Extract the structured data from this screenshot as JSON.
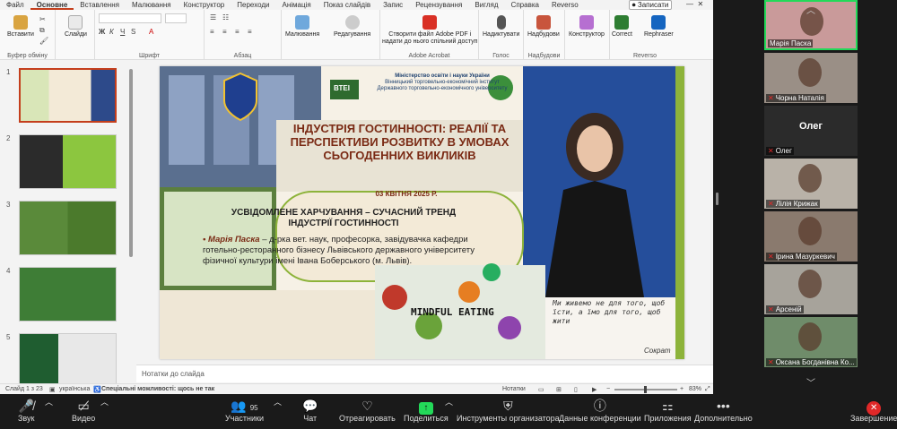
{
  "ribbon": {
    "tabs": [
      "Файл",
      "Основне",
      "Вставлення",
      "Малювання",
      "Конструктор",
      "Переходи",
      "Анімація",
      "Показ слайдів",
      "Запис",
      "Рецензування",
      "Вигляд",
      "Справка",
      "Reverso"
    ],
    "active_tab": "Основне",
    "record_label": "Записати",
    "groups": {
      "clipboard": {
        "paste": "Вставити",
        "label": "Буфер обміну"
      },
      "slides": {
        "new": "Слайди",
        "label": ""
      },
      "font": {
        "label": "Шрифт"
      },
      "paragraph": {
        "label": "Абзац"
      },
      "drawing": {
        "shapes": "Малювання",
        "edit": "Редагування"
      },
      "acrobat": {
        "create": "Створити файл Adobe PDF і",
        "create2": "надати до нього спільний доступ",
        "label": "Adobe Acrobat"
      },
      "voice": {
        "dictate": "Надиктувати",
        "label": "Голос"
      },
      "addins": {
        "addins": "Надбудови",
        "label": "Надбудови"
      },
      "designer": {
        "designer": "Конструктор"
      },
      "reverso": {
        "correct": "Correct",
        "rephrase": "Rephraser",
        "label": "Reverso"
      }
    }
  },
  "slide": {
    "ministry": "Міністерство освіти і науки України",
    "institute": "Вінницький торговельно-економічний інститут",
    "university": "Державного торговельно-економічного університету",
    "vtei": "ВТЕІ",
    "conf_title": "ІНДУСТРІЯ ГОСТИННОСТІ: РЕАЛІЇ ТА ПЕРСПЕКТИВИ РОЗВИТКУ В УМОВАХ СЬОГОДЕННИХ ВИКЛИКІВ",
    "date": "03 КВІТНЯ 2025 Р.",
    "talk_title": "УСВІДОМЛЕНЕ ХАРЧУВАННЯ – СУЧАСНИЙ ТРЕНД ІНДУСТРІЇ ГОСТИННОСТІ",
    "speaker": "Марія Паска",
    "speaker_info": " – д-рка вет. наук, професорка, завідувачка кафедри готельно-ресторанного бізнесу Львівського державного університету фізичної культури імені Івана Боберського (м. Львів).",
    "mindful": "MINDFUL EATING",
    "quote": "Ми живемо не для того, щоб їсти, а їмо для того, щоб жити",
    "quote_author": "Сократ"
  },
  "thumbnails": [
    "1",
    "2",
    "3",
    "4",
    "5"
  ],
  "notes_placeholder": "Нотатки до слайда",
  "status": {
    "slide_count": "Слайд 1 з 23",
    "language": "українська",
    "accessibility": "Спеціальні можливості: щось не так",
    "notes": "Нотатки",
    "zoom": "83%"
  },
  "participants": [
    {
      "name": "Марія Паска",
      "muted": false,
      "active": true,
      "video": true
    },
    {
      "name": "Чорна Наталія",
      "muted": true,
      "active": false,
      "video": true
    },
    {
      "name": "Олег",
      "muted": true,
      "active": false,
      "video": false
    },
    {
      "name": "Лілія Крижак",
      "muted": true,
      "active": false,
      "video": true
    },
    {
      "name": "Ірина Мазуркевич",
      "muted": true,
      "active": false,
      "video": true
    },
    {
      "name": "Арсеній",
      "muted": true,
      "active": false,
      "video": true
    },
    {
      "name": "Оксана Богданівна Ко...",
      "muted": true,
      "active": false,
      "video": true
    }
  ],
  "toolbar": {
    "audio": "Звук",
    "video": "Видео",
    "participants": "Участники",
    "participants_count": "95",
    "chat": "Чат",
    "react": "Отреагировать",
    "share": "Поделиться",
    "host_tools": "Инструменты организатора",
    "conf_info": "Данные конференции",
    "apps": "Приложения",
    "more": "Дополнительно",
    "end": "Завершение"
  },
  "colors": {
    "accent": "#c43e1c",
    "slide_green": "#8db33a",
    "slide_title": "#7a2a14",
    "zoom_green": "#23d959",
    "zoom_red": "#e02828"
  }
}
